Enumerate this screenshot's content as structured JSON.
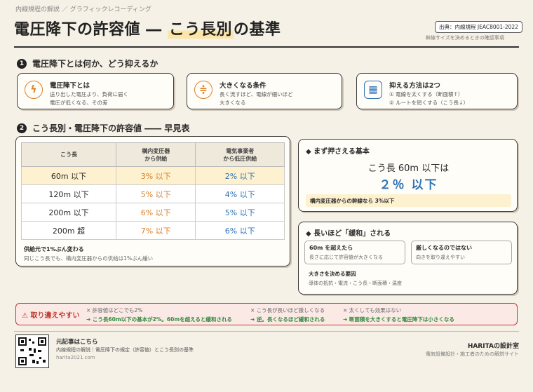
{
  "header": {
    "subtitle": "内線規程の解説 ／ グラフィックレコーディング",
    "title_main": "電圧降下の許容値 ― ",
    "title_highlight": "こう長別",
    "title_tail": "の基準",
    "source": "出典：内線規程 JEAC8001-2022",
    "source_note": "幹線サイズを決めるときの確認事項"
  },
  "section1": {
    "number": "1",
    "title": "電圧降下とは何か、どう抑えるか",
    "cards": [
      {
        "icon": "lightning-icon",
        "title": "電圧降下とは",
        "lines": [
          "送り出した電圧より、負荷に届く",
          "電圧が低くなる、その差"
        ]
      },
      {
        "icon": "cable-icon",
        "title": "大きくなる条件",
        "lines": [
          "長く流すほど、電線が細いほど",
          "大きくなる"
        ]
      },
      {
        "icon": "calculator-icon",
        "title": "抑える方法は2つ",
        "lines": [
          "① 電線を太くする（断面積↑）",
          "② ルートを短くする（こう長↓）"
        ]
      }
    ]
  },
  "section2": {
    "number": "2",
    "title": "こう長別・電圧降下の許容値 ―― 早見表",
    "table": {
      "headers": [
        "こう長",
        "構内変圧器\nから供給",
        "電気事業者\nから低圧供給"
      ],
      "rows": [
        [
          "60m 以下",
          "3% 以下",
          "2% 以下"
        ],
        [
          "120m 以下",
          "5% 以下",
          "4% 以下"
        ],
        [
          "200m 以下",
          "6% 以下",
          "5% 以下"
        ],
        [
          "200m 超",
          "7% 以下",
          "6% 以下"
        ]
      ]
    },
    "note_title": "供給元で1%ぶん変わる",
    "note_text": "同じこう長でも、構内変圧器からの供給は1%ぶん緩い"
  },
  "basic": {
    "title": "まず押さえる基本",
    "line1": "こう長 60m 以下は",
    "line2": "２％ 以下",
    "footer": "構内変圧器からの幹線なら 3%以下"
  },
  "relax": {
    "title": "長いほど「緩和」される",
    "box1_title": "60m を超えたら",
    "box1_text": "長さに応じて許容値が大きくなる",
    "box2_title": "厳しくなるのではない",
    "box2_text": "向きを取り違えやすい",
    "box3_title": "大きさを決める要因",
    "box3_text": "導体の抵抗・電流・こう長・断面積・温度"
  },
  "warning": {
    "label": "取り違えやすい",
    "items": [
      {
        "wrong": "× 許容値はどこでも2%",
        "right": "➜ こう長60m以下の基本が2%。60mを超えると緩和される"
      },
      {
        "wrong": "× こう長が長いほど厳しくなる",
        "right": "➜ 逆。長くなるほど緩和される"
      },
      {
        "wrong": "× 太くしても効果はない",
        "right": "➜ 断面積を大きくすると電圧降下は小さくなる"
      }
    ]
  },
  "footer": {
    "qr_title": "元記事はこちら",
    "qr_line1": "内線規程の解説｜電圧降下の規定（許容値）とこう長別の基準",
    "qr_url": "harita2021.com",
    "brand": "HARITAの設計室",
    "brand_sub": "電気設備設計・施工者のための解説サイト"
  },
  "colors": {
    "accent_yellow": "#fbe6a8",
    "orange": "#d9822b",
    "blue": "#2f73b8",
    "warn_red": "#c0392b",
    "green": "#2e8b3a"
  }
}
